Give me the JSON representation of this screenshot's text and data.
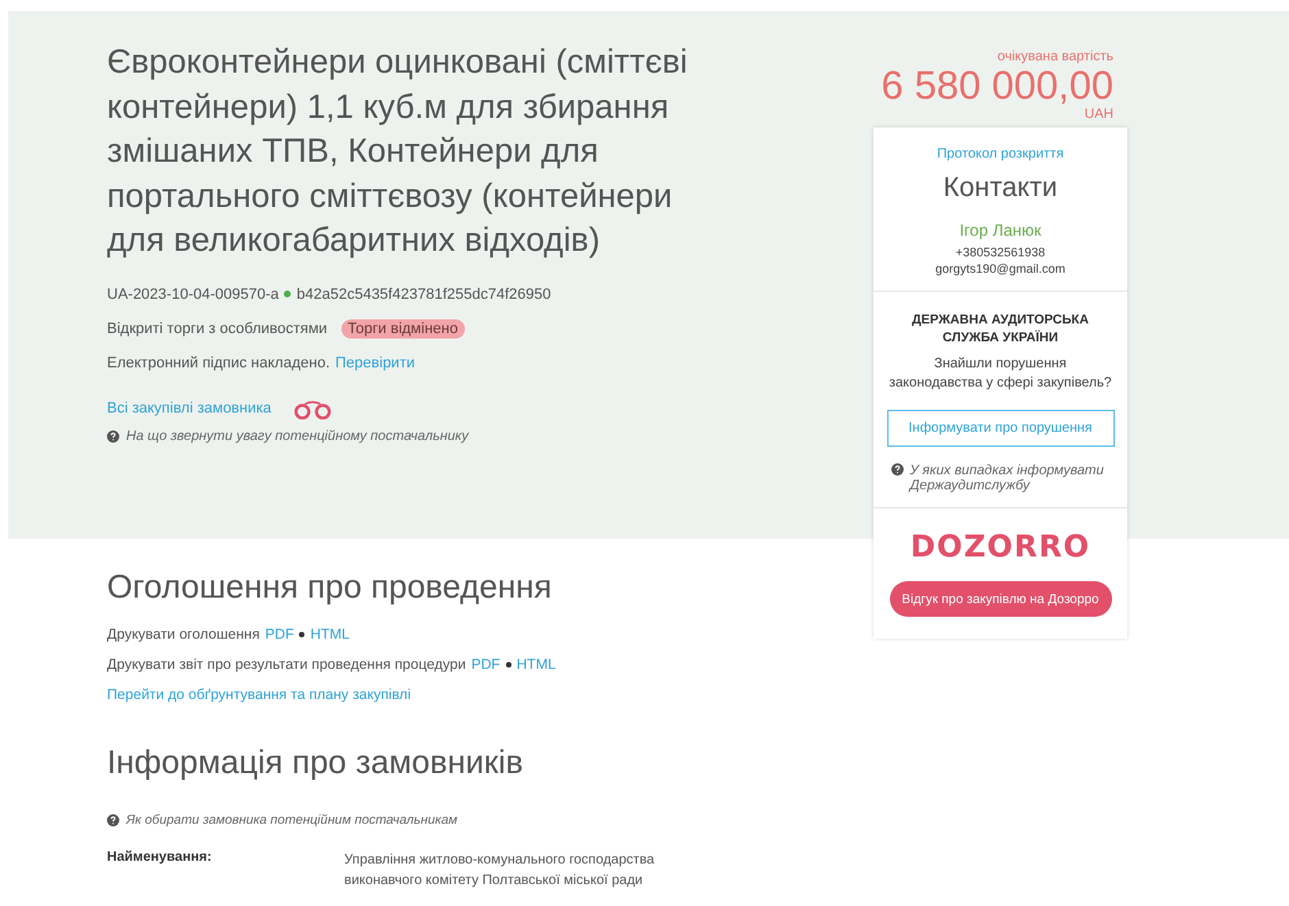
{
  "title": "Євроконтейнери оцинковані (сміттєві контейнери) 1,1 куб.м для збирання змішаних ТПВ, Контейнери для портального сміттєвозу (контейнери для великогабаритних відходів)",
  "tender_id": "UA-2023-10-04-009570-a",
  "hash": "b42a52c5435f423781f255dc74f26950",
  "procedure_type": "Відкриті торги з особливостями",
  "status_badge": "Торги відмінено",
  "signature": {
    "text": "Електронний підпис накладено.",
    "link": "Перевірити"
  },
  "customer_link": "Всі закупівлі замовника",
  "help_text": "На що звернути увагу потенційному постачальнику",
  "price": {
    "label": "очікувана вартість",
    "value": "6 580 000,00",
    "currency": "UAH"
  },
  "contacts": {
    "protocol_link": "Протокол розкриття",
    "heading": "Контакти",
    "name": "Ігор Ланюк",
    "phone": "+380532561938",
    "email": "gorgyts190@gmail.com"
  },
  "audit": {
    "heading": "ДЕРЖАВНА АУДИТОРСЬКА СЛУЖБА УКРАЇНИ",
    "question": "Знайшли порушення законодавства у сфері закупівель?",
    "button": "Інформувати про порушення",
    "help": "У яких випадках інформувати Держаудитслужбу"
  },
  "dozorro": {
    "logo": "DOZORRO",
    "button": "Відгук про закупівлю на Дозорро"
  },
  "announcement": {
    "heading": "Оголошення про проведення",
    "print_rows": [
      {
        "label": "Друкувати оголошення",
        "links": [
          "PDF",
          "HTML"
        ]
      },
      {
        "label": "Друкувати звіт про результати проведення процедури",
        "links": [
          "PDF",
          "HTML"
        ]
      }
    ],
    "plan_link": "Перейти до обґрунтування та плану закупівлі"
  },
  "customers": {
    "heading": "Інформація про замовників",
    "help": "Як обирати замовника потенційним постачальникам",
    "fields": [
      {
        "label": "Найменування:",
        "value": "Управління житлово-комунального господарства виконавчого комітету Полтавської міської ради"
      }
    ]
  }
}
